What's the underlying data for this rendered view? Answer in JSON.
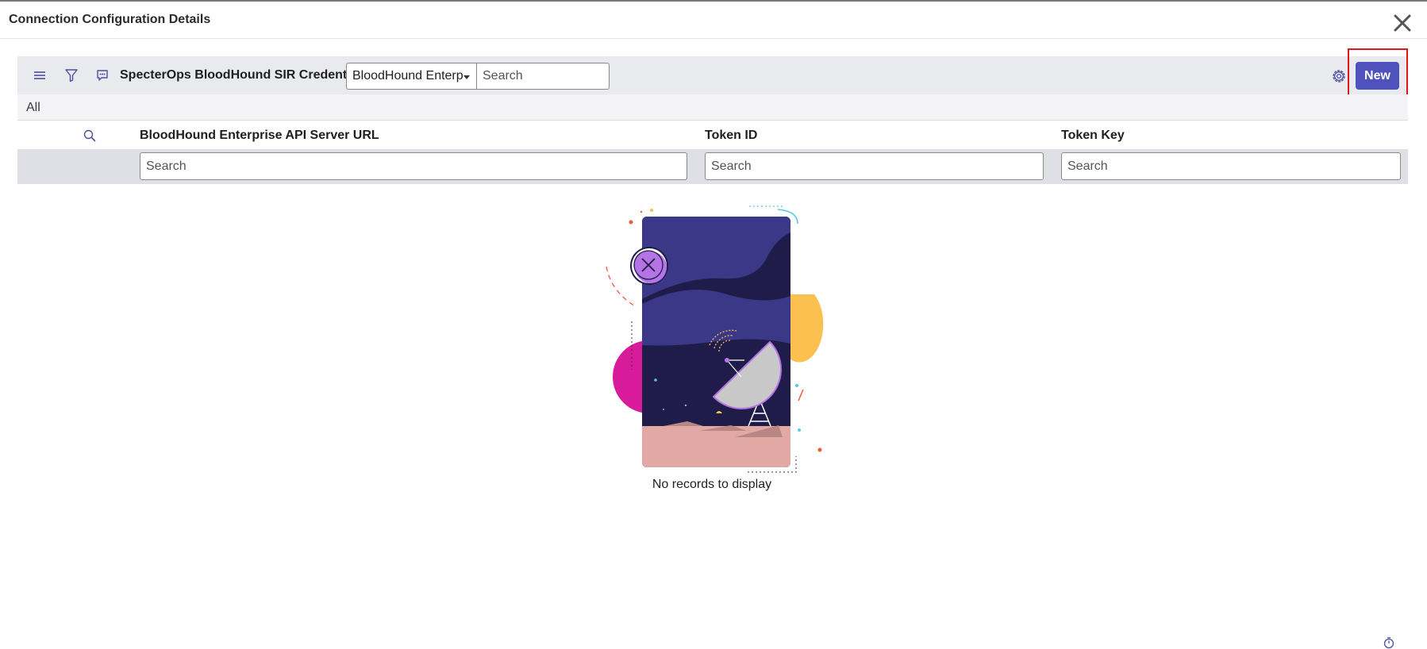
{
  "modal": {
    "title": "Connection Configuration Details",
    "close_icon": "close-icon"
  },
  "toolbar": {
    "menu_icon": "hamburger-menu-icon",
    "filter_icon": "filter-icon",
    "activity_icon": "chat-bubble-icon",
    "list_title": "SpecterOps BloodHound SIR Credentials",
    "search_field_select": "BloodHound Enterp",
    "search_placeholder": "Search",
    "settings_icon": "gear-icon",
    "new_label": "New"
  },
  "breadcrumb": {
    "all_label": "All"
  },
  "table": {
    "search_icon": "search-icon",
    "columns": [
      {
        "label": "BloodHound Enterprise API Server URL",
        "search_placeholder": "Search"
      },
      {
        "label": "Token ID",
        "search_placeholder": "Search"
      },
      {
        "label": "Token Key",
        "search_placeholder": "Search"
      }
    ],
    "rows": []
  },
  "empty_state": {
    "message": "No records to display",
    "illustration": "satellite-dish-illustration"
  },
  "footer": {
    "timer_icon": "stopwatch-icon"
  },
  "colors": {
    "primary_button": "#4f52bd",
    "highlight": "#e3141b",
    "toolbar_bg": "#e9eaee"
  }
}
